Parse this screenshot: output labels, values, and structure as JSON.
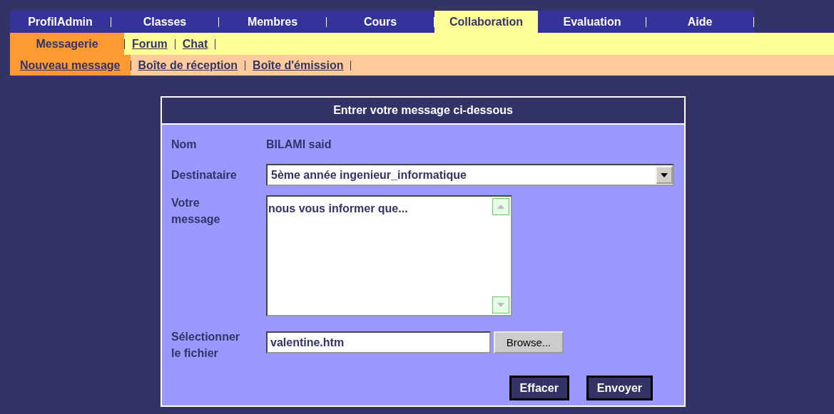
{
  "main_menu": [
    {
      "label": "ProfilAdmin",
      "selected": false
    },
    {
      "label": "Classes",
      "selected": false
    },
    {
      "label": "Membres",
      "selected": false
    },
    {
      "label": "Cours",
      "selected": false
    },
    {
      "label": "Collaboration",
      "selected": true
    },
    {
      "label": "Evaluation",
      "selected": false
    },
    {
      "label": "Aide",
      "selected": false
    }
  ],
  "sub_menu": [
    {
      "label": "Messagerie",
      "selected": true
    },
    {
      "label": "Forum",
      "selected": false
    },
    {
      "label": "Chat",
      "selected": false
    }
  ],
  "sub_sub_menu": [
    {
      "label": "Nouveau message",
      "selected": true
    },
    {
      "label": "Boîte de réception",
      "selected": false
    },
    {
      "label": "Boîte d'émission",
      "selected": false
    }
  ],
  "form": {
    "title": "Entrer votre message ci-dessous",
    "name_label": "Nom",
    "name_value": "BILAMI said",
    "recipient_label": "Destinataire",
    "recipient_value": "5ème année ingenieur_informatique",
    "message_label": "Votre message",
    "message_value": "nous vous informer que...",
    "file_label": "Sélectionner le fichier",
    "file_value": "valentine.htm",
    "browse_button": "Browse...",
    "buttons": [
      "Effacer",
      "Envoyer"
    ]
  }
}
